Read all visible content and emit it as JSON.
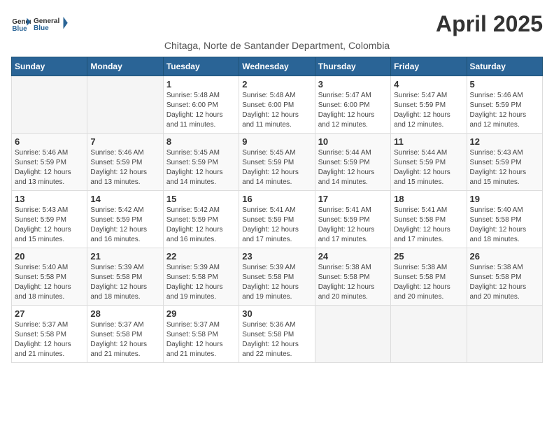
{
  "header": {
    "logo_general": "General",
    "logo_blue": "Blue",
    "month": "April 2025",
    "location": "Chitaga, Norte de Santander Department, Colombia"
  },
  "weekdays": [
    "Sunday",
    "Monday",
    "Tuesday",
    "Wednesday",
    "Thursday",
    "Friday",
    "Saturday"
  ],
  "weeks": [
    [
      {
        "day": "",
        "info": ""
      },
      {
        "day": "",
        "info": ""
      },
      {
        "day": "1",
        "info": "Sunrise: 5:48 AM\nSunset: 6:00 PM\nDaylight: 12 hours and 11 minutes."
      },
      {
        "day": "2",
        "info": "Sunrise: 5:48 AM\nSunset: 6:00 PM\nDaylight: 12 hours and 11 minutes."
      },
      {
        "day": "3",
        "info": "Sunrise: 5:47 AM\nSunset: 6:00 PM\nDaylight: 12 hours and 12 minutes."
      },
      {
        "day": "4",
        "info": "Sunrise: 5:47 AM\nSunset: 5:59 PM\nDaylight: 12 hours and 12 minutes."
      },
      {
        "day": "5",
        "info": "Sunrise: 5:46 AM\nSunset: 5:59 PM\nDaylight: 12 hours and 12 minutes."
      }
    ],
    [
      {
        "day": "6",
        "info": "Sunrise: 5:46 AM\nSunset: 5:59 PM\nDaylight: 12 hours and 13 minutes."
      },
      {
        "day": "7",
        "info": "Sunrise: 5:46 AM\nSunset: 5:59 PM\nDaylight: 12 hours and 13 minutes."
      },
      {
        "day": "8",
        "info": "Sunrise: 5:45 AM\nSunset: 5:59 PM\nDaylight: 12 hours and 14 minutes."
      },
      {
        "day": "9",
        "info": "Sunrise: 5:45 AM\nSunset: 5:59 PM\nDaylight: 12 hours and 14 minutes."
      },
      {
        "day": "10",
        "info": "Sunrise: 5:44 AM\nSunset: 5:59 PM\nDaylight: 12 hours and 14 minutes."
      },
      {
        "day": "11",
        "info": "Sunrise: 5:44 AM\nSunset: 5:59 PM\nDaylight: 12 hours and 15 minutes."
      },
      {
        "day": "12",
        "info": "Sunrise: 5:43 AM\nSunset: 5:59 PM\nDaylight: 12 hours and 15 minutes."
      }
    ],
    [
      {
        "day": "13",
        "info": "Sunrise: 5:43 AM\nSunset: 5:59 PM\nDaylight: 12 hours and 15 minutes."
      },
      {
        "day": "14",
        "info": "Sunrise: 5:42 AM\nSunset: 5:59 PM\nDaylight: 12 hours and 16 minutes."
      },
      {
        "day": "15",
        "info": "Sunrise: 5:42 AM\nSunset: 5:59 PM\nDaylight: 12 hours and 16 minutes."
      },
      {
        "day": "16",
        "info": "Sunrise: 5:41 AM\nSunset: 5:59 PM\nDaylight: 12 hours and 17 minutes."
      },
      {
        "day": "17",
        "info": "Sunrise: 5:41 AM\nSunset: 5:59 PM\nDaylight: 12 hours and 17 minutes."
      },
      {
        "day": "18",
        "info": "Sunrise: 5:41 AM\nSunset: 5:58 PM\nDaylight: 12 hours and 17 minutes."
      },
      {
        "day": "19",
        "info": "Sunrise: 5:40 AM\nSunset: 5:58 PM\nDaylight: 12 hours and 18 minutes."
      }
    ],
    [
      {
        "day": "20",
        "info": "Sunrise: 5:40 AM\nSunset: 5:58 PM\nDaylight: 12 hours and 18 minutes."
      },
      {
        "day": "21",
        "info": "Sunrise: 5:39 AM\nSunset: 5:58 PM\nDaylight: 12 hours and 18 minutes."
      },
      {
        "day": "22",
        "info": "Sunrise: 5:39 AM\nSunset: 5:58 PM\nDaylight: 12 hours and 19 minutes."
      },
      {
        "day": "23",
        "info": "Sunrise: 5:39 AM\nSunset: 5:58 PM\nDaylight: 12 hours and 19 minutes."
      },
      {
        "day": "24",
        "info": "Sunrise: 5:38 AM\nSunset: 5:58 PM\nDaylight: 12 hours and 20 minutes."
      },
      {
        "day": "25",
        "info": "Sunrise: 5:38 AM\nSunset: 5:58 PM\nDaylight: 12 hours and 20 minutes."
      },
      {
        "day": "26",
        "info": "Sunrise: 5:38 AM\nSunset: 5:58 PM\nDaylight: 12 hours and 20 minutes."
      }
    ],
    [
      {
        "day": "27",
        "info": "Sunrise: 5:37 AM\nSunset: 5:58 PM\nDaylight: 12 hours and 21 minutes."
      },
      {
        "day": "28",
        "info": "Sunrise: 5:37 AM\nSunset: 5:58 PM\nDaylight: 12 hours and 21 minutes."
      },
      {
        "day": "29",
        "info": "Sunrise: 5:37 AM\nSunset: 5:58 PM\nDaylight: 12 hours and 21 minutes."
      },
      {
        "day": "30",
        "info": "Sunrise: 5:36 AM\nSunset: 5:58 PM\nDaylight: 12 hours and 22 minutes."
      },
      {
        "day": "",
        "info": ""
      },
      {
        "day": "",
        "info": ""
      },
      {
        "day": "",
        "info": ""
      }
    ]
  ]
}
